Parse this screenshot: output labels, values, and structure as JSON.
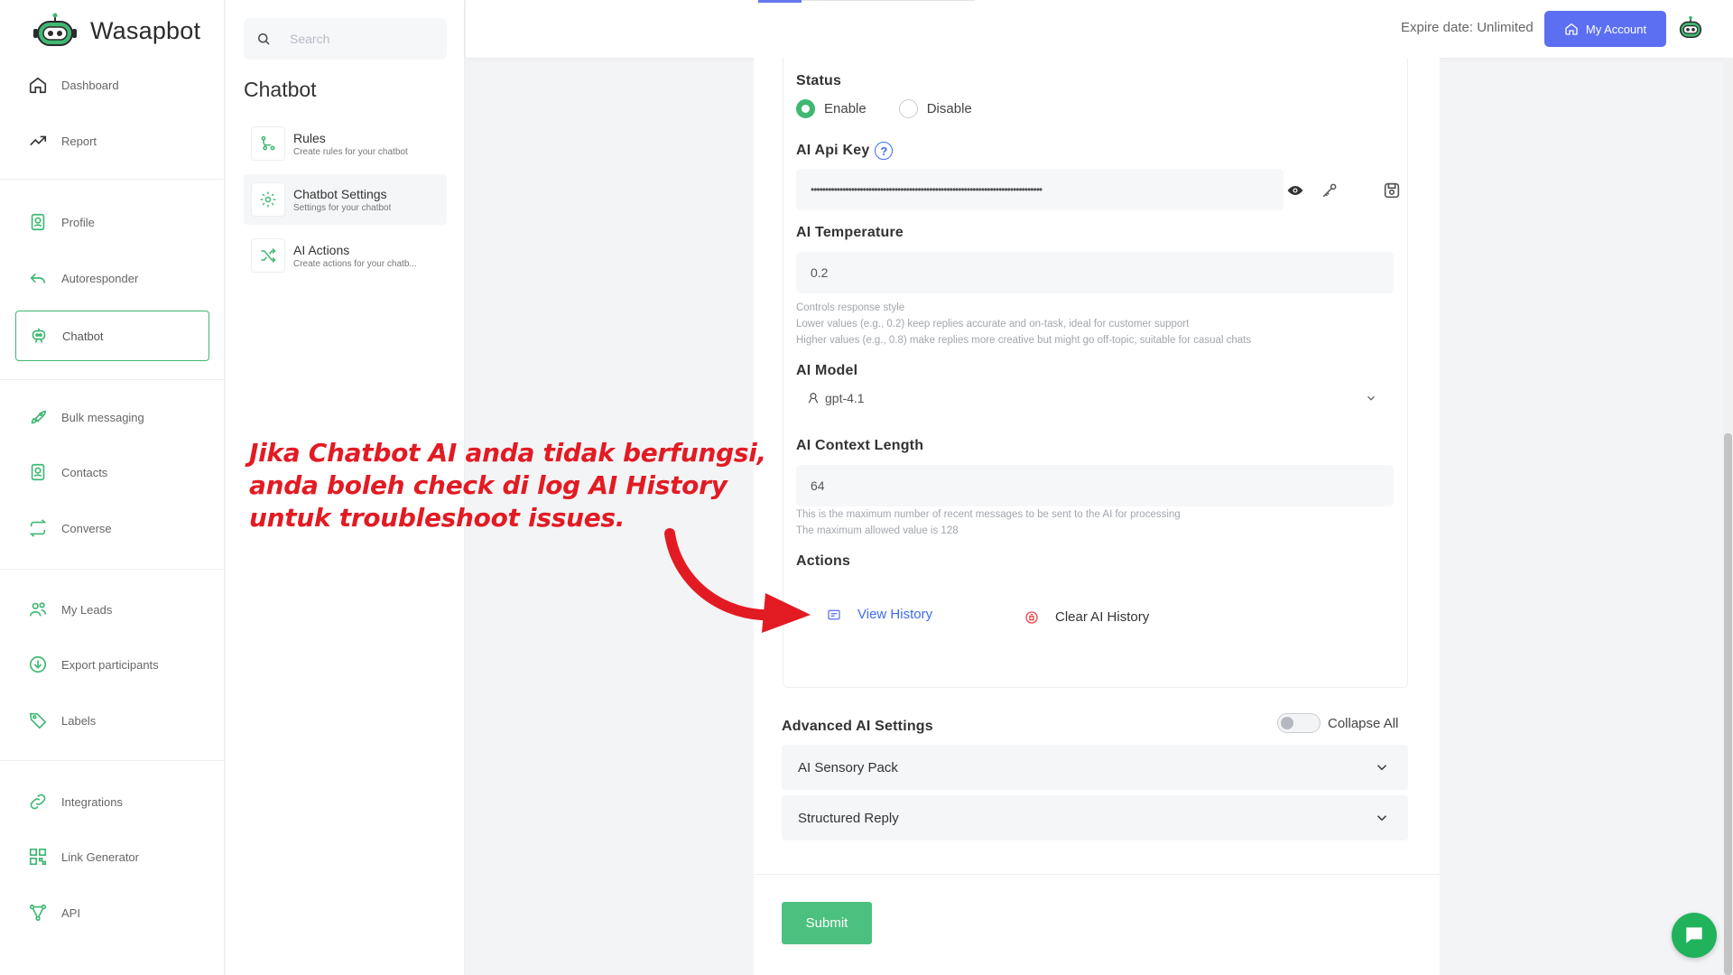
{
  "brand": {
    "name": "Wasapbot"
  },
  "nav": {
    "items": [
      {
        "label": "Dashboard",
        "icon": "home-icon"
      },
      {
        "label": "Report",
        "icon": "trend-icon"
      },
      {
        "label": "Profile",
        "icon": "profile-icon"
      },
      {
        "label": "Autoresponder",
        "icon": "reply-icon"
      },
      {
        "label": "Chatbot",
        "icon": "robot-icon"
      },
      {
        "label": "Bulk messaging",
        "icon": "rocket-icon"
      },
      {
        "label": "Contacts",
        "icon": "contacts-icon"
      },
      {
        "label": "Converse",
        "icon": "repeat-icon"
      },
      {
        "label": "My Leads",
        "icon": "users-icon"
      },
      {
        "label": "Export participants",
        "icon": "cloud-download-icon"
      },
      {
        "label": "Labels",
        "icon": "tag-icon"
      },
      {
        "label": "Integrations",
        "icon": "link-icon"
      },
      {
        "label": "Link Generator",
        "icon": "qr-icon"
      },
      {
        "label": "API",
        "icon": "api-icon"
      }
    ]
  },
  "subnav": {
    "search_placeholder": "Search",
    "title": "Chatbot",
    "items": [
      {
        "title": "Rules",
        "subtitle": "Create rules for your chatbot"
      },
      {
        "title": "Chatbot Settings",
        "subtitle": "Settings for your chatbot"
      },
      {
        "title": "AI Actions",
        "subtitle": "Create actions for your chatb..."
      }
    ]
  },
  "header": {
    "expire_text": "Expire date: Unlimited",
    "account_button": "My Account"
  },
  "form": {
    "status_label": "Status",
    "status_enable": "Enable",
    "status_disable": "Disable",
    "status_value": "Enable",
    "api_key_label": "AI Api Key",
    "api_key_help": "?",
    "api_key_value": "••••••••••••••••••••••••••••••••••••••••••••••••••••••••••••••••••••••••••••••••",
    "temperature_label": "AI Temperature",
    "temperature_value": "0.2",
    "temperature_hint_1": "Controls response style",
    "temperature_hint_2": "Lower values (e.g., 0.2) keep replies accurate and on-task, ideal for customer support",
    "temperature_hint_3": "Higher values (e.g., 0.8) make replies more creative but might go off-topic, suitable for casual chats",
    "model_label": "AI Model",
    "model_value": "gpt-4.1",
    "context_label": "AI Context Length",
    "context_value": "64",
    "context_hint_1": "This is the maximum number of recent messages to be sent to the AI for processing",
    "context_hint_2": "The maximum allowed value is 128",
    "actions_label": "Actions",
    "view_history": "View History",
    "clear_history": "Clear AI History",
    "advanced_title": "Advanced AI Settings",
    "collapse_all": "Collapse All",
    "accordion_1": "AI Sensory Pack",
    "accordion_2": "Structured Reply",
    "submit": "Submit"
  },
  "annotation": {
    "line_1": "Jika Chatbot AI anda tidak berfungsi,",
    "line_2": "anda boleh check di log AI History",
    "line_3": "untuk troubleshoot issues."
  },
  "colors": {
    "accent_green": "#3fb873",
    "account_blue": "#5c6ff2",
    "link_blue": "#3b6df0",
    "annotation_red": "#e21b23",
    "clear_red": "#e5484d"
  }
}
